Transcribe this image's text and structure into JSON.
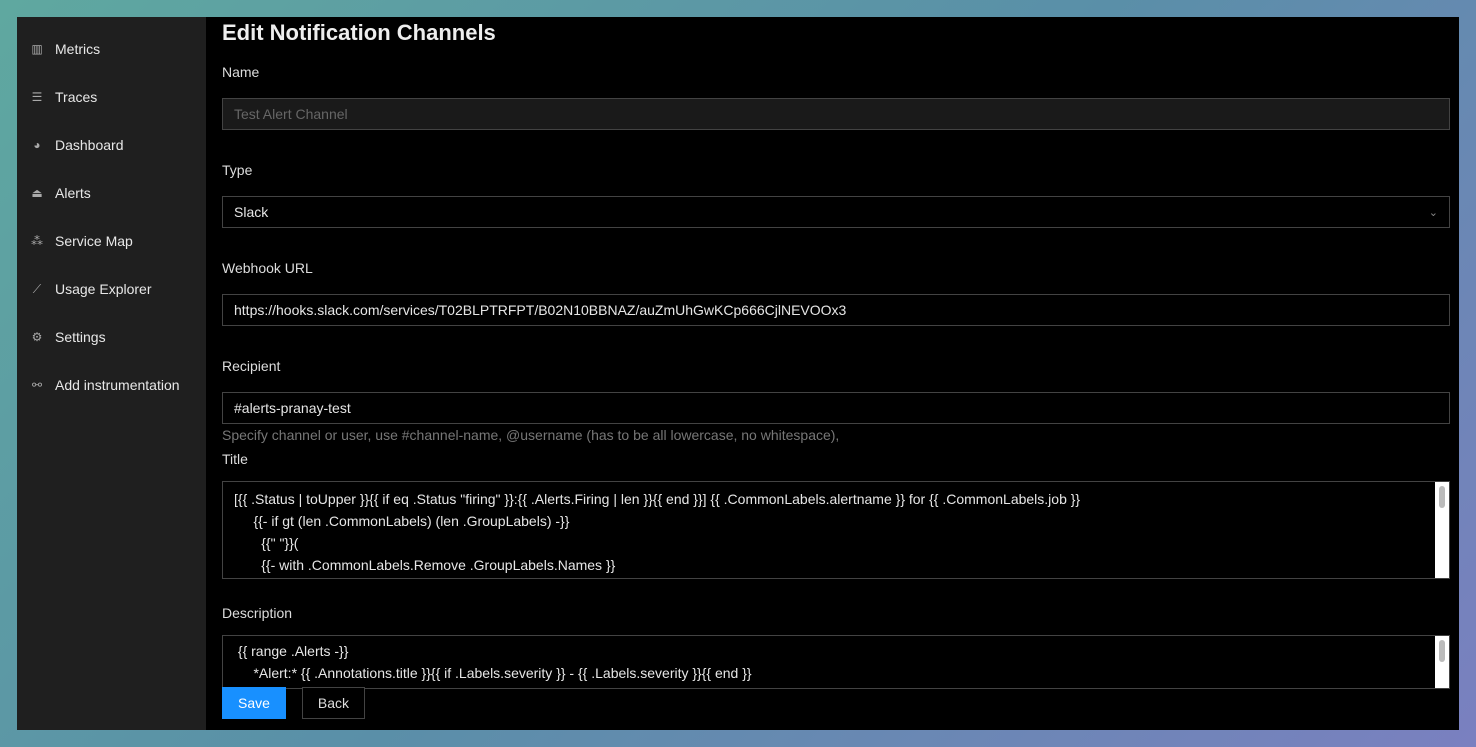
{
  "sidebar": {
    "items": [
      {
        "label": "Metrics",
        "icon": "bar-chart-icon"
      },
      {
        "label": "Traces",
        "icon": "align-left-icon"
      },
      {
        "label": "Dashboard",
        "icon": "dashboard-icon"
      },
      {
        "label": "Alerts",
        "icon": "alarm-icon"
      },
      {
        "label": "Service Map",
        "icon": "deployment-unit-icon"
      },
      {
        "label": "Usage Explorer",
        "icon": "line-chart-icon"
      },
      {
        "label": "Settings",
        "icon": "gear-icon"
      },
      {
        "label": "Add instrumentation",
        "icon": "api-icon"
      }
    ]
  },
  "form": {
    "title": "Edit Notification Channels",
    "name_label": "Name",
    "name_placeholder": "Test Alert Channel",
    "type_label": "Type",
    "type_value": "Slack",
    "webhook_label": "Webhook URL",
    "webhook_value": "https://hooks.slack.com/services/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",
    "recipient_label": "Recipient",
    "recipient_value": "#alerts-pranay-test",
    "recipient_help": "Specify channel or user, use #channel-name, @username (has to be all lowercase, no whitespace),",
    "title_label": "Title",
    "title_value": "[{{ .Status | toUpper }}{{ if eq .Status \"firing\" }}:{{ .Alerts.Firing | len }}{{ end }}] {{ .CommonLabels.alertname }} for {{ .CommonLabels.job }}\n     {{- if gt (len .CommonLabels) (len .GroupLabels) -}}\n       {{\" \"}}(\n       {{- with .CommonLabels.Remove .GroupLabels.Names }}",
    "description_label": "Description",
    "description_value": " {{ range .Alerts -}}\n     *Alert:* {{ .Annotations.title }}{{ if .Labels.severity }} - {{ .Labels.severity }}{{ end }}",
    "save": "Save",
    "back": "Back"
  }
}
